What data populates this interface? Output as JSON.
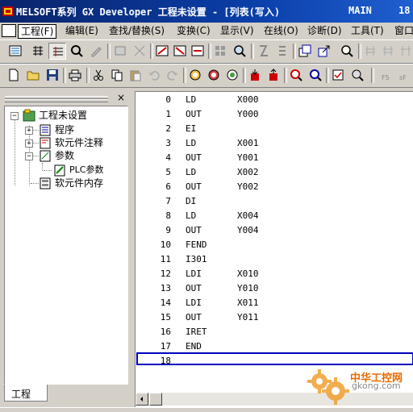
{
  "window": {
    "title": "MELSOFT系列 GX Developer 工程未设置 - [列表(写入)",
    "program_name": "MAIN",
    "right_fragment": "18"
  },
  "menu": [
    {
      "label": "工程(F)",
      "active": true
    },
    {
      "label": "编辑(E)"
    },
    {
      "label": "查找/替换(S)"
    },
    {
      "label": "变换(C)"
    },
    {
      "label": "显示(V)"
    },
    {
      "label": "在线(O)"
    },
    {
      "label": "诊断(D)"
    },
    {
      "label": "工具(T)"
    },
    {
      "label": "窗口"
    }
  ],
  "toolbar_icons_row1": [
    "ladder-view-icon",
    "list-view-icon",
    "list-edit-icon",
    "monitor-icon",
    "write-icon",
    "comment-icon",
    "device-icon",
    "ladder-write-icon",
    "ladder-read-icon",
    "ladder-verify-icon",
    "block-icon",
    "search-icon",
    "step-icon",
    "step2-icon",
    "window-tile-icon",
    "window-cascade-icon",
    "zoom-icon",
    "dev1-icon",
    "dev2-icon",
    "dev3-icon"
  ],
  "toolbar_icons_row2": [
    "new-icon",
    "open-icon",
    "save-icon",
    "print-icon",
    "cut-icon",
    "copy-icon",
    "paste-icon",
    "undo-icon",
    "redo-icon",
    "find-device-icon",
    "find-ins-icon",
    "find-step-icon",
    "read-plc-icon",
    "write-plc-icon",
    "monitor-start-icon",
    "monitor-stop-icon",
    "param-check-icon",
    "transfer-icon"
  ],
  "toolbar_f5_label": "F5",
  "toolbar_sf_label": "sF",
  "tree": {
    "close_symbol": "×",
    "root": "工程未设置",
    "items": [
      {
        "label": "程序",
        "level": 1,
        "expander": "+"
      },
      {
        "label": "软元件注释",
        "level": 1,
        "expander": "+"
      },
      {
        "label": "参数",
        "level": 1,
        "expander": "−"
      },
      {
        "label": "PLC参数",
        "level": 2
      },
      {
        "label": "软元件内存",
        "level": 1
      }
    ],
    "tab_label": "工程"
  },
  "list": {
    "rows": [
      {
        "step": "0",
        "ins": "LD",
        "dev": "X000"
      },
      {
        "step": "1",
        "ins": "OUT",
        "dev": "Y000"
      },
      {
        "step": "2",
        "ins": "EI",
        "dev": ""
      },
      {
        "step": "3",
        "ins": "LD",
        "dev": "X001"
      },
      {
        "step": "4",
        "ins": "OUT",
        "dev": "Y001"
      },
      {
        "step": "5",
        "ins": "LD",
        "dev": "X002"
      },
      {
        "step": "6",
        "ins": "OUT",
        "dev": "Y002"
      },
      {
        "step": "7",
        "ins": "DI",
        "dev": ""
      },
      {
        "step": "8",
        "ins": "LD",
        "dev": "X004"
      },
      {
        "step": "9",
        "ins": "OUT",
        "dev": "Y004"
      },
      {
        "step": "10",
        "ins": "FEND",
        "dev": ""
      },
      {
        "step": "11",
        "ins": "I301",
        "dev": ""
      },
      {
        "step": "12",
        "ins": "LDI",
        "dev": "X010"
      },
      {
        "step": "13",
        "ins": "OUT",
        "dev": "Y010"
      },
      {
        "step": "14",
        "ins": "LDI",
        "dev": "X011"
      },
      {
        "step": "15",
        "ins": "OUT",
        "dev": "Y011"
      },
      {
        "step": "16",
        "ins": "IRET",
        "dev": ""
      },
      {
        "step": "17",
        "ins": "END",
        "dev": ""
      },
      {
        "step": "18",
        "ins": "",
        "dev": ""
      }
    ]
  },
  "watermark": {
    "cn": "中华工控网",
    "url": "gkong.com"
  },
  "colors": {
    "titlebar": "#0a246a",
    "cursor": "#0000c0",
    "face": "#d4d0c8",
    "watermark": "#e86a00"
  }
}
